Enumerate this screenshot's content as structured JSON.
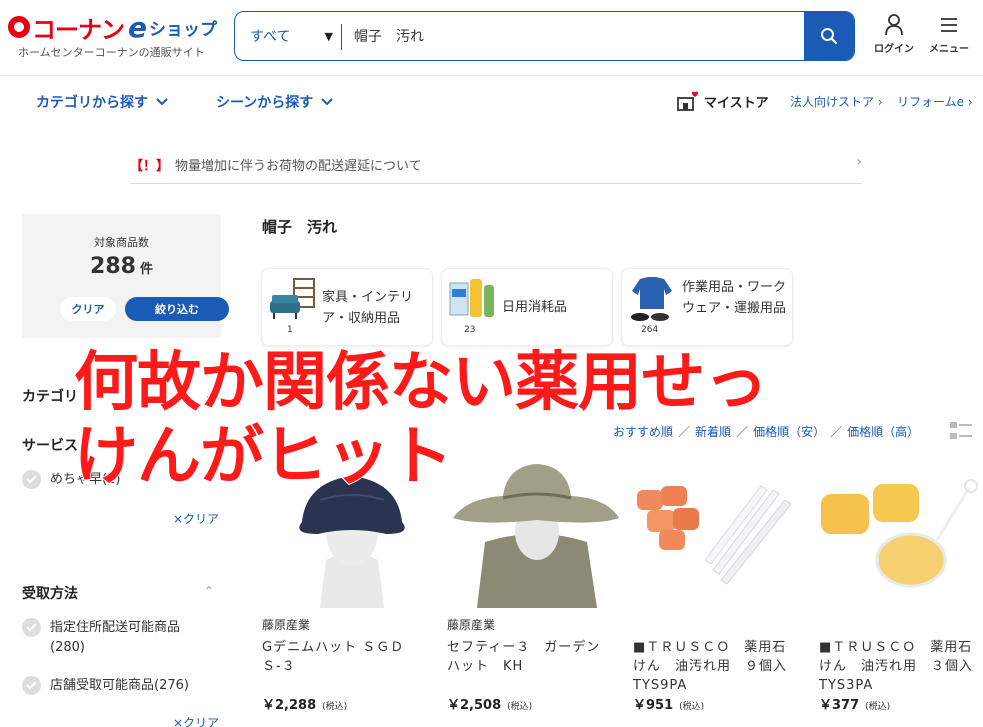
{
  "header": {
    "logo_main": "コーナン",
    "logo_e": "e",
    "logo_shop": "ショップ",
    "logo_sub": "ホームセンターコーナンの通販サイト",
    "search_category": "すべて",
    "search_query": "帽子　汚れ",
    "login_label": "ログイン",
    "menu_label": "メニュー"
  },
  "nav": {
    "category_search": "カテゴリから探す",
    "scene_search": "シーンから探す",
    "mystore": "マイストア",
    "corporate_store": "法人向けストア",
    "reform": "リフォームe"
  },
  "notice": {
    "mark": "【！】",
    "text": "物量増加に伴うお荷物の配送遅延について"
  },
  "sidebar": {
    "count_label": "対象商品数",
    "count_value": "288",
    "count_unit": "件",
    "clear_button": "クリア",
    "filter_button": "絞り込む",
    "category_heading": "カテゴリ",
    "service_heading": "サービス",
    "service_option": "めちゃ早(1)",
    "clear_link": "×クリア",
    "pickup_heading": "受取方法",
    "pickup_option1_line1": "指定住所配送可能商品",
    "pickup_option1_line2": "(280)",
    "pickup_option2": "店舗受取可能商品(276)",
    "pickup_clear": "×クリア"
  },
  "main": {
    "query_title": "帽子　汚れ",
    "categories": [
      {
        "label": "家具・インテリア・収納用品",
        "count": "1"
      },
      {
        "label": "日用消耗品",
        "count": "23"
      },
      {
        "label": "作業用品・ワークウェア・運搬用品",
        "count": "264"
      }
    ],
    "sort": {
      "recommended": "おすすめ順",
      "newest": "新着順",
      "price_low": "価格順（安）",
      "price_high": "価格順（高）",
      "separator": "／"
    },
    "products": [
      {
        "maker": "藤原産業",
        "name": "Gデニムハット ＳＧＤＳ-３",
        "price": "￥2,288",
        "tax": "(税込)"
      },
      {
        "maker": "藤原産業",
        "name": "セフティー３　ガーデンハット　KH",
        "price": "￥2,508",
        "tax": "(税込)"
      },
      {
        "maker": "",
        "name": "■ＴＲＵＳＣＯ　薬用石けん　油汚れ用　９個入 TYS9PA",
        "price": "￥951",
        "tax": "(税込)"
      },
      {
        "maker": "",
        "name": "■ＴＲＵＳＣＯ　薬用石けん　油汚れ用　３個入 TYS3PA",
        "price": "￥377",
        "tax": "(税込)"
      }
    ]
  },
  "overlay": {
    "line1": "何故か関係ない薬用せっ",
    "line2": "けんがヒット"
  },
  "colors": {
    "brand_red": "#e60012",
    "brand_blue": "#1a5bb5",
    "overlay_red": "#ff1a1a"
  }
}
